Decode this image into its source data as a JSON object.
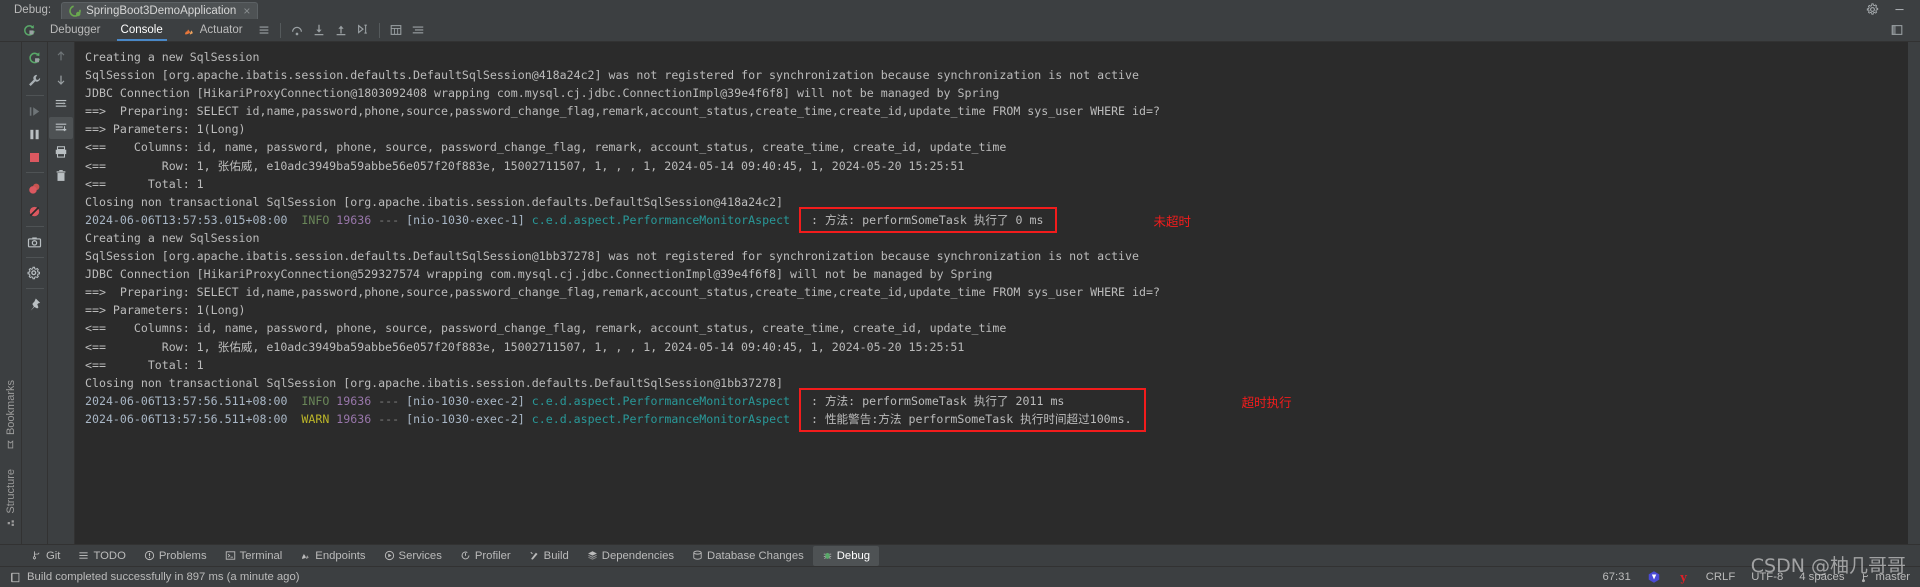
{
  "window": {
    "debug_label": "Debug:",
    "run_config_name": "SpringBoot3DemoApplication",
    "close_label": "×",
    "settings_icon": "gear-icon",
    "minimize_icon": "minimize-icon"
  },
  "subtabs": {
    "rerun_icon": "rerun-icon",
    "items": [
      {
        "label": "Debugger",
        "icon": "debugger-icon",
        "active": false
      },
      {
        "label": "Console",
        "icon": "console-icon",
        "active": true
      },
      {
        "label": "Actuator",
        "icon": "actuator-icon",
        "active": false
      }
    ],
    "tool_icons": [
      "layout-icon",
      "step-over-icon",
      "step-into-icon",
      "step-out-icon",
      "run-to-cursor-icon",
      "evaluate-icon",
      "soft-wrap-icon"
    ],
    "right_icon": "settings-icon"
  },
  "left_stripe": {
    "items": [
      {
        "label": "Bookmarks",
        "icon": "bookmark-icon"
      },
      {
        "label": "Structure",
        "icon": "structure-icon"
      }
    ]
  },
  "debug_toolbar": {
    "buttons": [
      {
        "name": "rerun-button",
        "icon": "rerun-icon"
      },
      {
        "name": "edit-configurations-button",
        "icon": "wrench-icon"
      },
      {
        "name": "resume-program-button",
        "icon": "resume-icon"
      },
      {
        "name": "pause-program-button",
        "icon": "pause-icon"
      },
      {
        "name": "stop-button",
        "icon": "stop-icon"
      },
      {
        "name": "view-breakpoints-button",
        "icon": "breakpoints-icon"
      },
      {
        "name": "mute-breakpoints-button",
        "icon": "mute-breakpoints-icon"
      },
      {
        "name": "screenshot-button",
        "icon": "camera-icon"
      },
      {
        "name": "settings-button",
        "icon": "gear-icon"
      },
      {
        "name": "pin-tab-button",
        "icon": "pin-icon"
      }
    ]
  },
  "console_toolbar": {
    "buttons": [
      {
        "name": "scroll-up-button",
        "icon": "arrow-up-icon"
      },
      {
        "name": "scroll-down-button",
        "icon": "arrow-down-icon"
      },
      {
        "name": "soft-wrap-button",
        "icon": "soft-wrap-icon"
      },
      {
        "name": "scroll-to-end-button",
        "icon": "scroll-end-icon"
      },
      {
        "name": "print-button",
        "icon": "print-icon"
      },
      {
        "name": "clear-all-button",
        "icon": "trash-icon"
      }
    ]
  },
  "console": {
    "lines": [
      {
        "type": "plain",
        "text": "Creating a new SqlSession"
      },
      {
        "type": "plain",
        "text": "SqlSession [org.apache.ibatis.session.defaults.DefaultSqlSession@418a24c2] was not registered for synchronization because synchronization is not active"
      },
      {
        "type": "plain",
        "text": "JDBC Connection [HikariProxyConnection@1803092408 wrapping com.mysql.cj.jdbc.ConnectionImpl@39e4f6f8] will not be managed by Spring"
      },
      {
        "type": "plain",
        "text": "==>  Preparing: SELECT id,name,password,phone,source,password_change_flag,remark,account_status,create_time,create_id,update_time FROM sys_user WHERE id=?"
      },
      {
        "type": "plain",
        "text": "==> Parameters: 1(Long)"
      },
      {
        "type": "plain",
        "text": "<==    Columns: id, name, password, phone, source, password_change_flag, remark, account_status, create_time, create_id, update_time"
      },
      {
        "type": "plain",
        "text": "<==        Row: 1, 张佑威, e10adc3949ba59abbe56e057f20f883e, 15002711507, 1, , , 1, 2024-05-14 09:40:45, 1, 2024-05-20 15:25:51"
      },
      {
        "type": "plain",
        "text": "<==      Total: 1"
      },
      {
        "type": "plain",
        "text": "Closing non transactional SqlSession [org.apache.ibatis.session.defaults.DefaultSqlSession@418a24c2]"
      },
      {
        "type": "log",
        "timestamp": "2024-06-06T13:57:53.015+08:00",
        "level": "INFO",
        "pid": "19636",
        "sep": "---",
        "thread": "[nio-1030-exec-1]",
        "logger": "c.e.d.aspect.PerformanceMonitorAspect",
        "message": ": 方法: performSomeTask 执行了 0 ms"
      },
      {
        "type": "plain",
        "text": "Creating a new SqlSession"
      },
      {
        "type": "plain",
        "text": "SqlSession [org.apache.ibatis.session.defaults.DefaultSqlSession@1bb37278] was not registered for synchronization because synchronization is not active"
      },
      {
        "type": "plain",
        "text": "JDBC Connection [HikariProxyConnection@529327574 wrapping com.mysql.cj.jdbc.ConnectionImpl@39e4f6f8] will not be managed by Spring"
      },
      {
        "type": "plain",
        "text": "==>  Preparing: SELECT id,name,password,phone,source,password_change_flag,remark,account_status,create_time,create_id,update_time FROM sys_user WHERE id=?"
      },
      {
        "type": "plain",
        "text": "==> Parameters: 1(Long)"
      },
      {
        "type": "plain",
        "text": "<==    Columns: id, name, password, phone, source, password_change_flag, remark, account_status, create_time, create_id, update_time"
      },
      {
        "type": "plain",
        "text": "<==        Row: 1, 张佑威, e10adc3949ba59abbe56e057f20f883e, 15002711507, 1, , , 1, 2024-05-14 09:40:45, 1, 2024-05-20 15:25:51"
      },
      {
        "type": "plain",
        "text": "<==      Total: 1"
      },
      {
        "type": "plain",
        "text": "Closing non transactional SqlSession [org.apache.ibatis.session.defaults.DefaultSqlSession@1bb37278]"
      },
      {
        "type": "log",
        "timestamp": "2024-06-06T13:57:56.511+08:00",
        "level": "INFO",
        "pid": "19636",
        "sep": "---",
        "thread": "[nio-1030-exec-2]",
        "logger": "c.e.d.aspect.PerformanceMonitorAspect",
        "message": ": 方法: performSomeTask 执行了 2011 ms"
      },
      {
        "type": "log",
        "timestamp": "2024-06-06T13:57:56.511+08:00",
        "level": "WARN",
        "pid": "19636",
        "sep": "---",
        "thread": "[nio-1030-exec-2]",
        "logger": "c.e.d.aspect.PerformanceMonitorAspect",
        "message": ": 性能警告:方法 performSomeTask 执行时间超过100ms."
      }
    ],
    "annotations": [
      {
        "name": "annotation-not-timed-out",
        "text": "未超时",
        "color": "#f21c1c"
      },
      {
        "name": "annotation-timed-out",
        "text": "超时执行",
        "color": "#f21c1c"
      }
    ],
    "highlight_color": "#f21c1c"
  },
  "bottom_bar": {
    "items": [
      {
        "label": "Git",
        "icon": "git-icon",
        "active": false
      },
      {
        "label": "TODO",
        "icon": "todo-icon",
        "active": false
      },
      {
        "label": "Problems",
        "icon": "problems-icon",
        "active": false
      },
      {
        "label": "Terminal",
        "icon": "terminal-icon",
        "active": false
      },
      {
        "label": "Endpoints",
        "icon": "endpoints-icon",
        "active": false
      },
      {
        "label": "Services",
        "icon": "services-icon",
        "active": false
      },
      {
        "label": "Profiler",
        "icon": "profiler-icon",
        "active": false
      },
      {
        "label": "Build",
        "icon": "build-icon",
        "active": false
      },
      {
        "label": "Dependencies",
        "icon": "dependencies-icon",
        "active": false
      },
      {
        "label": "Database Changes",
        "icon": "database-changes-icon",
        "active": false
      },
      {
        "label": "Debug",
        "icon": "debug-icon",
        "active": true
      }
    ]
  },
  "status_bar": {
    "message": "Build completed successfully in 897 ms (a minute ago)",
    "message_icon": "build-status-icon",
    "caret_position": "67:31",
    "line_separator": "CRLF",
    "encoding": "UTF-8",
    "indent": "4 spaces",
    "branch": "master",
    "branch_icon": "git-branch-icon",
    "icons": [
      "idea-plugin-icon",
      "yandex-icon"
    ],
    "watermark": "CSDN @柚几哥哥"
  }
}
